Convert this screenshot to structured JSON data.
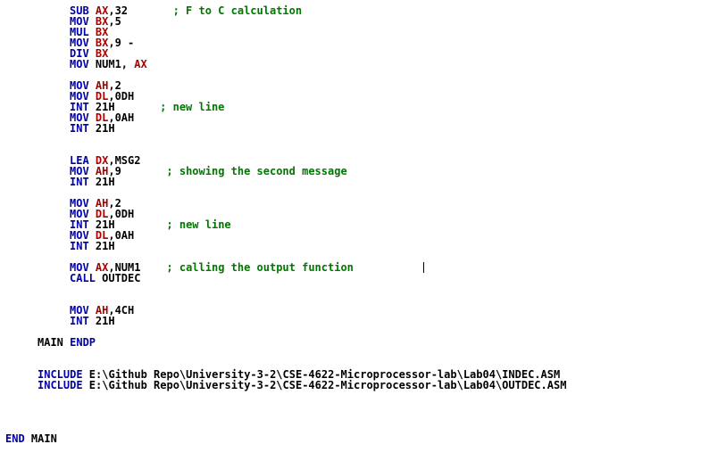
{
  "editor": {
    "lines": [
      {
        "tokens": [
          {
            "t": "SUB ",
            "c": "kw"
          },
          {
            "t": "AX",
            "c": "reg"
          },
          {
            "t": ",32       ",
            "c": "tx"
          },
          {
            "t": "; F to C calculation",
            "c": "cm"
          }
        ]
      },
      {
        "tokens": [
          {
            "t": "MOV ",
            "c": "kw"
          },
          {
            "t": "BX",
            "c": "reg"
          },
          {
            "t": ",5",
            "c": "tx"
          }
        ]
      },
      {
        "tokens": [
          {
            "t": "MUL ",
            "c": "kw"
          },
          {
            "t": "BX",
            "c": "reg"
          }
        ]
      },
      {
        "tokens": [
          {
            "t": "MOV ",
            "c": "kw"
          },
          {
            "t": "BX",
            "c": "reg"
          },
          {
            "t": ",9 -",
            "c": "tx"
          }
        ]
      },
      {
        "tokens": [
          {
            "t": "DIV ",
            "c": "kw"
          },
          {
            "t": "BX",
            "c": "reg"
          }
        ]
      },
      {
        "tokens": [
          {
            "t": "MOV ",
            "c": "kw"
          },
          {
            "t": "NUM1, ",
            "c": "tx"
          },
          {
            "t": "AX",
            "c": "reg"
          }
        ]
      },
      {
        "tokens": []
      },
      {
        "tokens": [
          {
            "t": "MOV ",
            "c": "kw"
          },
          {
            "t": "AH",
            "c": "reg"
          },
          {
            "t": ",2",
            "c": "tx"
          }
        ]
      },
      {
        "tokens": [
          {
            "t": "MOV ",
            "c": "kw"
          },
          {
            "t": "DL",
            "c": "reg"
          },
          {
            "t": ",0DH",
            "c": "tx"
          }
        ]
      },
      {
        "tokens": [
          {
            "t": "INT ",
            "c": "kw"
          },
          {
            "t": "21H       ",
            "c": "tx"
          },
          {
            "t": "; new line",
            "c": "cm"
          }
        ]
      },
      {
        "tokens": [
          {
            "t": "MOV ",
            "c": "kw"
          },
          {
            "t": "DL",
            "c": "reg"
          },
          {
            "t": ",0AH",
            "c": "tx"
          }
        ]
      },
      {
        "tokens": [
          {
            "t": "INT ",
            "c": "kw"
          },
          {
            "t": "21H",
            "c": "tx"
          }
        ]
      },
      {
        "tokens": []
      },
      {
        "tokens": []
      },
      {
        "tokens": [
          {
            "t": "LEA ",
            "c": "kw"
          },
          {
            "t": "DX",
            "c": "reg"
          },
          {
            "t": ",MSG2",
            "c": "tx"
          }
        ]
      },
      {
        "tokens": [
          {
            "t": "MOV ",
            "c": "kw"
          },
          {
            "t": "AH",
            "c": "reg"
          },
          {
            "t": ",9       ",
            "c": "tx"
          },
          {
            "t": "; showing the second message",
            "c": "cm"
          }
        ]
      },
      {
        "tokens": [
          {
            "t": "INT ",
            "c": "kw"
          },
          {
            "t": "21H",
            "c": "tx"
          }
        ]
      },
      {
        "tokens": []
      },
      {
        "tokens": [
          {
            "t": "MOV ",
            "c": "kw"
          },
          {
            "t": "AH",
            "c": "reg"
          },
          {
            "t": ",2",
            "c": "tx"
          }
        ]
      },
      {
        "tokens": [
          {
            "t": "MOV ",
            "c": "kw"
          },
          {
            "t": "DL",
            "c": "reg"
          },
          {
            "t": ",0DH",
            "c": "tx"
          }
        ]
      },
      {
        "tokens": [
          {
            "t": "INT ",
            "c": "kw"
          },
          {
            "t": "21H        ",
            "c": "tx"
          },
          {
            "t": "; new line",
            "c": "cm"
          }
        ]
      },
      {
        "tokens": [
          {
            "t": "MOV ",
            "c": "kw"
          },
          {
            "t": "DL",
            "c": "reg"
          },
          {
            "t": ",0AH",
            "c": "tx"
          }
        ]
      },
      {
        "tokens": [
          {
            "t": "INT ",
            "c": "kw"
          },
          {
            "t": "21H",
            "c": "tx"
          }
        ]
      },
      {
        "tokens": []
      },
      {
        "tokens": [
          {
            "t": "MOV ",
            "c": "kw"
          },
          {
            "t": "AX",
            "c": "reg"
          },
          {
            "t": ",NUM1    ",
            "c": "tx"
          },
          {
            "t": "; calling the output function",
            "c": "cm"
          }
        ]
      },
      {
        "tokens": [
          {
            "t": "CALL ",
            "c": "kw"
          },
          {
            "t": "OUTDEC",
            "c": "tx"
          }
        ]
      },
      {
        "tokens": []
      },
      {
        "tokens": []
      },
      {
        "tokens": [
          {
            "t": "MOV ",
            "c": "kw"
          },
          {
            "t": "AH",
            "c": "reg"
          },
          {
            "t": ",4CH",
            "c": "tx"
          }
        ]
      },
      {
        "tokens": [
          {
            "t": "INT ",
            "c": "kw"
          },
          {
            "t": "21H",
            "c": "tx"
          }
        ]
      },
      {
        "tokens": []
      },
      {
        "tokens": [
          {
            "t": "MAIN ",
            "c": "tx"
          },
          {
            "t": "ENDP",
            "c": "kw"
          }
        ]
      },
      {
        "tokens": []
      },
      {
        "tokens": []
      },
      {
        "tokens": [
          {
            "t": "INCLUDE ",
            "c": "kw"
          },
          {
            "t": "E:\\Github Repo\\University-3-2\\CSE-4622-Microprocessor-lab\\Lab04\\INDEC.ASM",
            "c": "tx"
          }
        ]
      },
      {
        "tokens": [
          {
            "t": "INCLUDE ",
            "c": "kw"
          },
          {
            "t": "E:\\Github Repo\\University-3-2\\CSE-4622-Microprocessor-lab\\Lab04\\OUTDEC.ASM",
            "c": "tx"
          }
        ]
      },
      {
        "tokens": []
      },
      {
        "tokens": []
      },
      {
        "tokens": []
      },
      {
        "tokens": []
      },
      {
        "tokens": [
          {
            "t": "END ",
            "c": "kw"
          },
          {
            "t": "MAIN",
            "c": "tx"
          }
        ]
      }
    ]
  }
}
